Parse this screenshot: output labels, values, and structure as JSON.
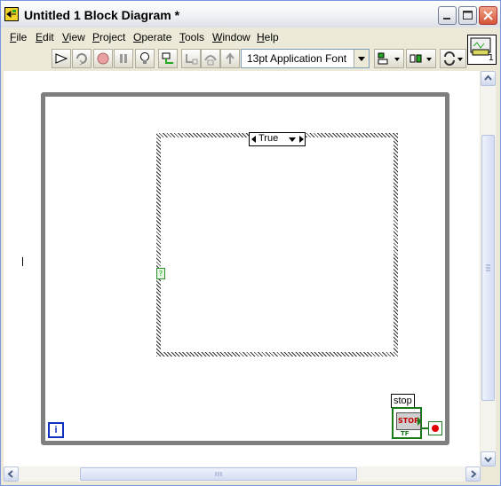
{
  "window": {
    "title": "Untitled 1 Block Diagram *"
  },
  "menu": [
    {
      "label": "File",
      "u": "F",
      "rest": "ile"
    },
    {
      "label": "Edit",
      "u": "E",
      "rest": "dit"
    },
    {
      "label": "View",
      "u": "V",
      "rest": "iew"
    },
    {
      "label": "Project",
      "u": "P",
      "rest": "roject"
    },
    {
      "label": "Operate",
      "u": "O",
      "rest": "perate"
    },
    {
      "label": "Tools",
      "u": "T",
      "rest": "ools"
    },
    {
      "label": "Window",
      "u": "W",
      "rest": "indow"
    },
    {
      "label": "Help",
      "u": "H",
      "rest": "elp"
    }
  ],
  "toolbar": {
    "font": "13pt Application Font"
  },
  "connector": {
    "label": "1"
  },
  "diagram": {
    "case_selector": "True",
    "selector_terminal": "?",
    "iteration_terminal": "i",
    "stop_label": "stop",
    "stop_button": "STOP",
    "stop_type": "TF"
  },
  "colors": {
    "wire_boolean": "#1a7a1a",
    "loop_index": "#1030c0",
    "stop_red": "#c00000"
  }
}
